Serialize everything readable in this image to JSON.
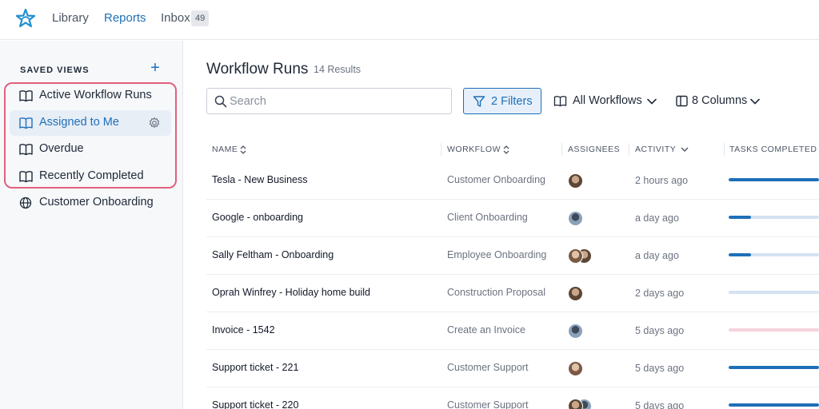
{
  "nav": {
    "library": "Library",
    "reports": "Reports",
    "inbox": "Inbox",
    "inbox_count": "49"
  },
  "sidebar": {
    "title": "SAVED VIEWS",
    "add": "+",
    "items": [
      {
        "label": "Active Workflow Runs",
        "icon": "book-icon"
      },
      {
        "label": "Assigned to Me",
        "icon": "book-icon",
        "active": true
      },
      {
        "label": "Overdue",
        "icon": "book-icon"
      },
      {
        "label": "Recently Completed",
        "icon": "book-icon"
      },
      {
        "label": "Customer Onboarding",
        "icon": "globe-icon"
      }
    ]
  },
  "main": {
    "title": "Workflow Runs",
    "results": "14 Results",
    "search_placeholder": "Search",
    "filters_label": "2 Filters",
    "workflows_label": "All Workflows",
    "columns_label": "8 Columns"
  },
  "table": {
    "headers": {
      "name": "NAME",
      "workflow": "WORKFLOW",
      "assignees": "ASSIGNEES",
      "activity": "ACTIVITY",
      "tasks": "TASKS COMPLETED"
    },
    "rows": [
      {
        "name": "Tesla - New Business",
        "workflow": "Customer Onboarding",
        "activity": "2 hours ago",
        "assignees": 1,
        "progress": 1.0
      },
      {
        "name": "Google - onboarding",
        "workflow": "Client Onboarding",
        "activity": "a day ago",
        "assignees": 1,
        "progress": 0.25
      },
      {
        "name": "Sally Feltham - Onboarding",
        "workflow": "Employee Onboarding",
        "activity": "a day ago",
        "assignees": 2,
        "progress": 0.25
      },
      {
        "name": "Oprah Winfrey - Holiday home build",
        "workflow": "Construction Proposal",
        "activity": "2 days ago",
        "assignees": 1,
        "progress": 0
      },
      {
        "name": "Invoice - 1542",
        "workflow": "Create an Invoice",
        "activity": "5 days ago",
        "assignees": 1,
        "progress": 0,
        "status": "pink"
      },
      {
        "name": "Support ticket - 221",
        "workflow": "Customer Support",
        "activity": "5 days ago",
        "assignees": 1,
        "progress": 1.0
      },
      {
        "name": "Support ticket - 220",
        "workflow": "Customer Support",
        "activity": "5 days ago",
        "assignees": 2,
        "progress": 1.0
      }
    ]
  },
  "colors": {
    "accent": "#1e6fb8",
    "highlight": "#e0607e",
    "sidebar_bg": "#f6f8fa"
  }
}
